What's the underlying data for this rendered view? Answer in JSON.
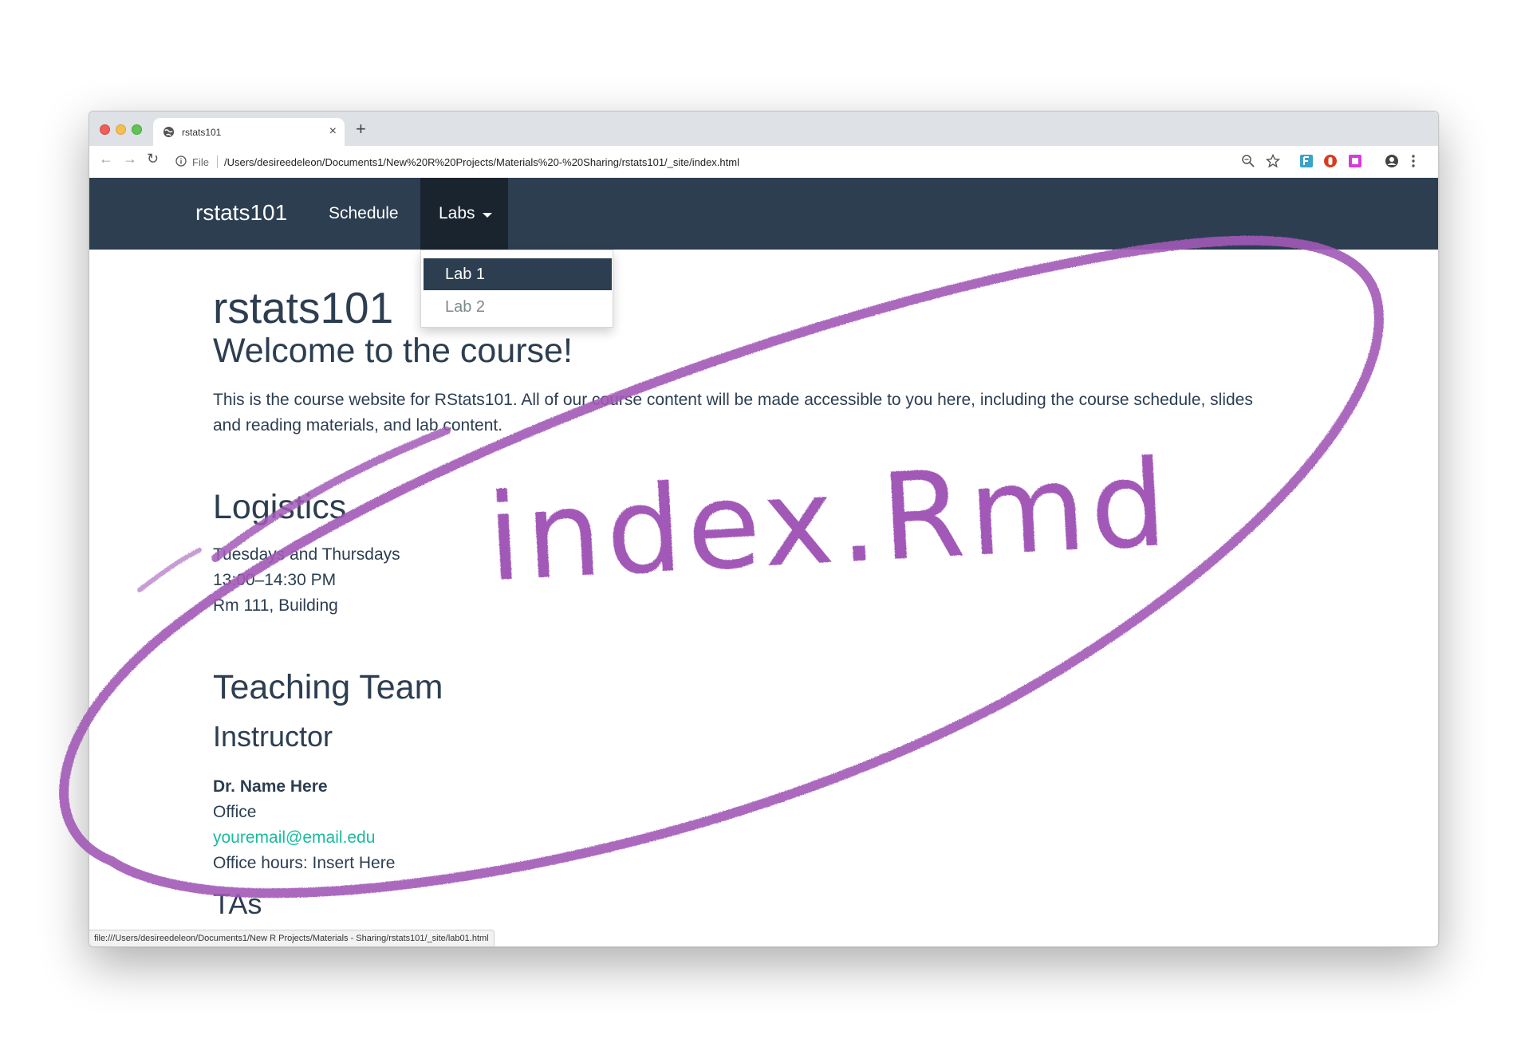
{
  "browser": {
    "tab_title": "rstats101",
    "new_tab_symbol": "+",
    "close_symbol": "×",
    "file_label": "File",
    "url": "/Users/desireedeleon/Documents1/New%20R%20Projects/Materials%20-%20Sharing/rstats101/_site/index.html",
    "status_url": "file:///Users/desireedeleon/Documents1/New R Projects/Materials - Sharing/rstats101/_site/lab01.html"
  },
  "navbar": {
    "brand": "rstats101",
    "schedule": "Schedule",
    "labs": "Labs",
    "dropdown": [
      "Lab 1",
      "Lab 2"
    ]
  },
  "page": {
    "title": "rstats101",
    "welcome": "Welcome to the course!",
    "intro_line1": "This is the course website for RStats101. All of our course content will be made accessible to you here, including the course schedule, slides",
    "intro_line2": "and reading materials, and lab content.",
    "logistics_heading": "Logistics",
    "logistics": [
      "Tuesdays and Thursdays",
      "13:00–14:30 PM",
      "Rm 111, Building"
    ],
    "team_heading": "Teaching Team",
    "instructor_heading": "Instructor",
    "instructor_name": "Dr. Name Here",
    "instructor_office": "Office",
    "instructor_email": "youremail@email.edu",
    "instructor_hours": "Office hours: Insert Here",
    "tas_heading": "TAs"
  },
  "annotation": {
    "text": "index.Rmd",
    "color": "#a259b7"
  },
  "icons": [
    "back-icon",
    "forward-icon",
    "reload-icon",
    "info-icon",
    "zoom-icon",
    "star-icon",
    "extension-icon",
    "profile-icon",
    "menu-icon",
    "globe-icon"
  ]
}
